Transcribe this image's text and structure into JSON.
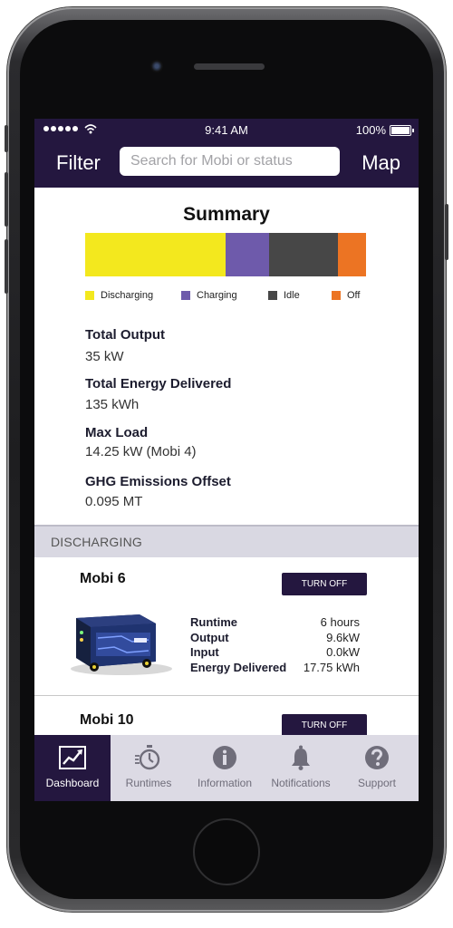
{
  "status_bar": {
    "time": "9:41 AM",
    "battery": "100%"
  },
  "header": {
    "filter_label": "Filter",
    "search_placeholder": "Search for Mobi or status",
    "map_label": "Map"
  },
  "summary": {
    "title": "Summary",
    "breakdown": [
      {
        "label": "Discharging",
        "fraction": 0.5,
        "color": "#f3e81e"
      },
      {
        "label": "Charging",
        "fraction": 0.155,
        "color": "#6e5aab"
      },
      {
        "label": "Idle",
        "fraction": 0.245,
        "color": "#474747"
      },
      {
        "label": "Off",
        "fraction": 0.1,
        "color": "#ec7423"
      }
    ],
    "stats": [
      {
        "label": "Total Output",
        "value": "35 kW"
      },
      {
        "label": "Total Energy Delivered",
        "value": "135 kWh"
      },
      {
        "label": "Max Load",
        "value": "14.25 kW (Mobi 4)"
      },
      {
        "label": "GHG Emissions Offset",
        "value": "0.095 MT"
      }
    ]
  },
  "section": {
    "title": "DISCHARGING"
  },
  "cards": [
    {
      "name": "Mobi 6",
      "button_label": "TURN OFF",
      "rows": [
        {
          "label": "Runtime",
          "value": "6 hours"
        },
        {
          "label": "Output",
          "value": "9.6kW"
        },
        {
          "label": "Input",
          "value": "0.0kW"
        },
        {
          "label": "Energy Delivered",
          "value": "17.75 kWh"
        }
      ]
    },
    {
      "name": "Mobi 10",
      "button_label": "TURN OFF"
    }
  ],
  "tabs": [
    {
      "label": "Dashboard",
      "icon": "trend-chart-icon",
      "active": true
    },
    {
      "label": "Runtimes",
      "icon": "stopwatch-icon"
    },
    {
      "label": "Information",
      "icon": "info-icon"
    },
    {
      "label": "Notifications",
      "icon": "bell-icon"
    },
    {
      "label": "Support",
      "icon": "help-icon"
    }
  ]
}
